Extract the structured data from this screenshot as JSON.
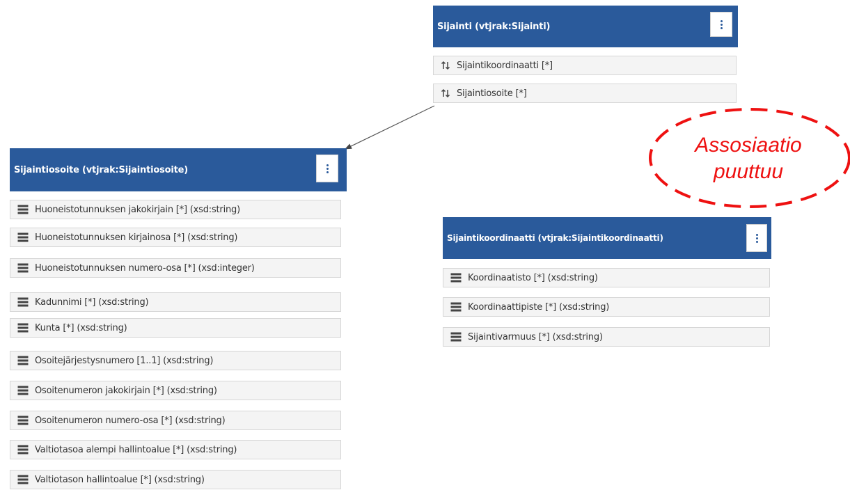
{
  "classes": {
    "sijainti": {
      "title": "Sijainti (vtjrak:Sijainti)",
      "attributes": [
        {
          "label": "Sijaintikoordinaatti [*]",
          "icon": "association-arrows-icon"
        },
        {
          "label": "Sijaintiosoite [*]",
          "icon": "association-arrows-icon"
        }
      ]
    },
    "sijaintiosoite": {
      "title": "Sijaintiosoite (vtjrak:Sijaintiosoite)",
      "attributes": [
        {
          "label": "Huoneistotunnuksen jakokirjain [*] (xsd:string)",
          "icon": "attribute-list-icon"
        },
        {
          "label": "Huoneistotunnuksen kirjainosa [*] (xsd:string)",
          "icon": "attribute-list-icon"
        },
        {
          "label": "Huoneistotunnuksen numero-osa [*] (xsd:integer)",
          "icon": "attribute-list-icon"
        },
        {
          "label": "Kadunnimi [*] (xsd:string)",
          "icon": "attribute-list-icon"
        },
        {
          "label": "Kunta [*] (xsd:string)",
          "icon": "attribute-list-icon"
        },
        {
          "label": "Osoitejärjestysnumero [1..1] (xsd:string)",
          "icon": "attribute-list-icon"
        },
        {
          "label": "Osoitenumeron jakokirjain [*] (xsd:string)",
          "icon": "attribute-list-icon"
        },
        {
          "label": "Osoitenumeron numero-osa [*] (xsd:string)",
          "icon": "attribute-list-icon"
        },
        {
          "label": "Valtiotasoa alempi hallintoalue [*] (xsd:string)",
          "icon": "attribute-list-icon"
        },
        {
          "label": "Valtiotason hallintoalue [*] (xsd:string)",
          "icon": "attribute-list-icon"
        }
      ]
    },
    "sijaintikoordinaatti": {
      "title": "Sijaintikoordinaatti (vtjrak:Sijaintikoordinaatti)",
      "attributes": [
        {
          "label": "Koordinaatisto [*] (xsd:string)",
          "icon": "attribute-list-icon"
        },
        {
          "label": "Koordinaattipiste [*] (xsd:string)",
          "icon": "attribute-list-icon"
        },
        {
          "label": "Sijaintivarmuus [*] (xsd:string)",
          "icon": "attribute-list-icon"
        }
      ]
    }
  },
  "callout": {
    "line1": "Assosiaatio",
    "line2": "puuttuu"
  },
  "colors": {
    "header": "#2a5a9b",
    "callout": "#ee1111",
    "attribute_bg": "#f4f4f4",
    "connector": "#555555"
  }
}
